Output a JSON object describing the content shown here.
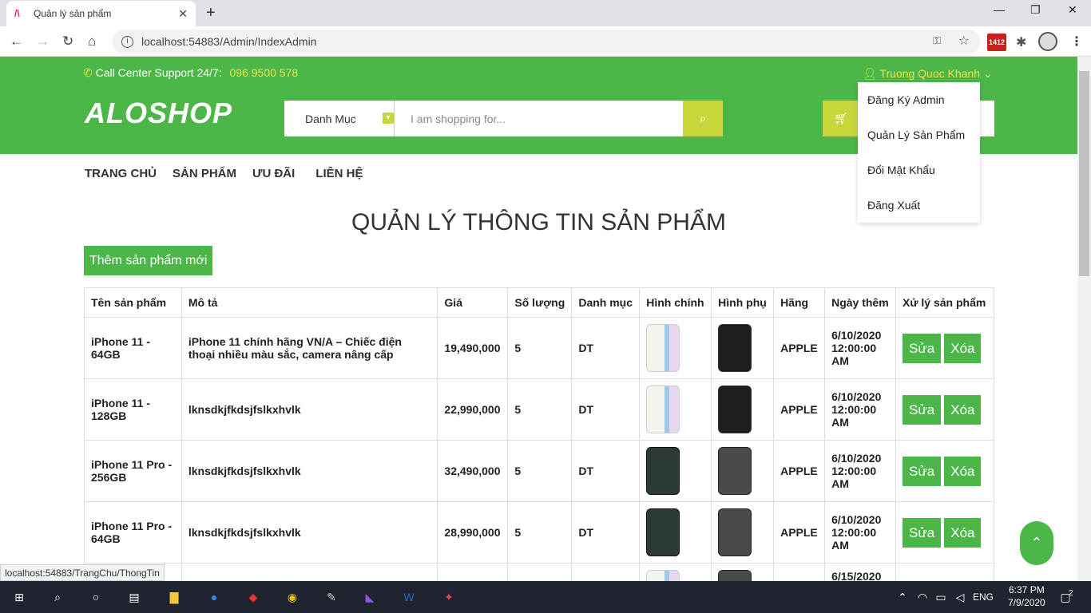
{
  "browser": {
    "tab_title": "Quản lý sản phẩm",
    "url": "localhost:54883/Admin/IndexAdmin",
    "ext_badge": "1412",
    "status_url": "localhost:54883/TrangChu/ThongTin"
  },
  "header": {
    "support_label": "Call Center Support 24/7:",
    "support_phone": "096 9500 578",
    "logo": "ALOSHOP",
    "category_label": "Danh Mục",
    "search_placeholder": "I am shopping for...",
    "user_name": "Truong Quoc Khanh",
    "user_menu": [
      "Đăng Ký Admin",
      "Quản Lý Sản Phẩm",
      "Đổi Mật Khẩu",
      "Đăng Xuất"
    ]
  },
  "nav": [
    "TRANG CHỦ",
    "SẢN PHẨM",
    "ƯU ĐÃI",
    "LIÊN HỆ"
  ],
  "page": {
    "title": "QUẢN LÝ THÔNG TIN SẢN PHẨM",
    "add_button": "Thêm sản phẩm mới"
  },
  "table": {
    "headers": [
      "Tên sản phẩm",
      "Mô tả",
      "Giá",
      "Số lượng",
      "Danh mục",
      "Hình chính",
      "Hình phụ",
      "Hãng",
      "Ngày thêm",
      "Xử lý sản phẩm"
    ],
    "edit_label": "Sửa",
    "delete_label": "Xóa",
    "rows": [
      {
        "name": "iPhone 11 - 64GB",
        "desc": "iPhone 11 chính hãng VN/A – Chiếc điện thoại nhiều màu sắc, camera nâng cấp",
        "price": "19,490,000",
        "qty": "5",
        "category": "DT",
        "brand": "APPLE",
        "date": "6/10/2020 12:00:00 AM"
      },
      {
        "name": "iPhone 11 - 128GB",
        "desc": "lknsdkjfkdsjfslkxhvlk",
        "price": "22,990,000",
        "qty": "5",
        "category": "DT",
        "brand": "APPLE",
        "date": "6/10/2020 12:00:00 AM"
      },
      {
        "name": "iPhone 11 Pro - 256GB",
        "desc": "lknsdkjfkdsjfslkxhvlk",
        "price": "32,490,000",
        "qty": "5",
        "category": "DT",
        "brand": "APPLE",
        "date": "6/10/2020 12:00:00 AM"
      },
      {
        "name": "iPhone 11 Pro - 64GB",
        "desc": "lknsdkjfkdsjfslkxhvlk",
        "price": "28,990,000",
        "qty": "5",
        "category": "DT",
        "brand": "APPLE",
        "date": "6/10/2020 12:00:00 AM"
      },
      {
        "name": "",
        "desc": "",
        "price": "",
        "qty": "",
        "category": "",
        "brand": "",
        "date": "6/15/2020"
      }
    ]
  },
  "taskbar": {
    "lang": "ENG",
    "time": "6:37 PM",
    "date": "7/9/2020",
    "notif": "2"
  }
}
